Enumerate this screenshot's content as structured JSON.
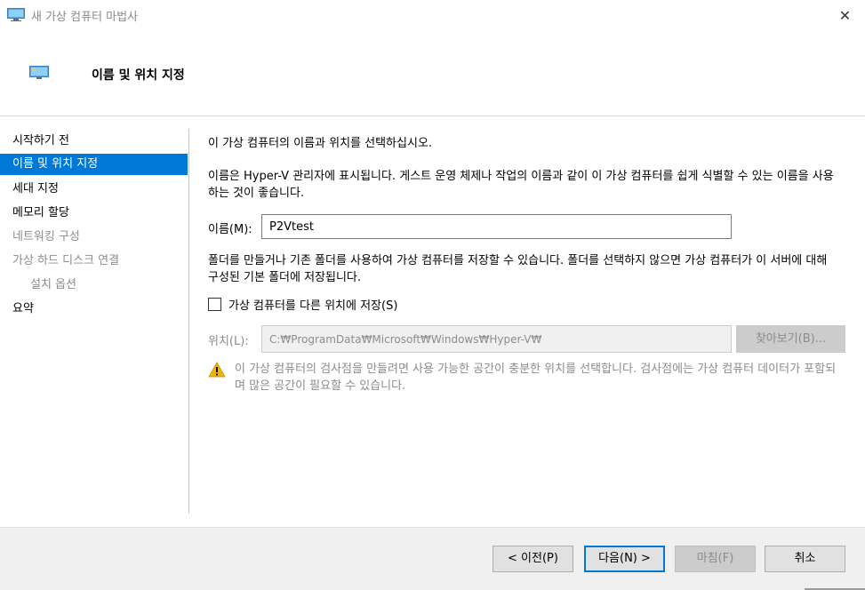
{
  "window": {
    "title": "새 가상 컴퓨터 마법사",
    "close_glyph": "✕"
  },
  "header": {
    "title": "이름 및 위치 지정"
  },
  "nav": {
    "items": [
      {
        "label": "시작하기 전",
        "state": "normal"
      },
      {
        "label": "이름 및 위치 지정",
        "state": "active"
      },
      {
        "label": "세대 지정",
        "state": "normal"
      },
      {
        "label": "메모리 할당",
        "state": "normal"
      },
      {
        "label": "네트워킹 구성",
        "state": "disabled"
      },
      {
        "label": "가상 하드 디스크 연결",
        "state": "disabled"
      },
      {
        "label": "설치 옵션",
        "state": "disabled"
      },
      {
        "label": "요약",
        "state": "normal"
      }
    ]
  },
  "content": {
    "intro": "이 가상 컴퓨터의 이름과 위치를 선택하십시오.",
    "description": "이름은 Hyper-V 관리자에 표시됩니다. 게스트 운영 체제나 작업의 이름과 같이 이 가상 컴퓨터를 쉽게 식별할 수 있는 이름을 사용하는 것이 좋습니다.",
    "name_label": "이름(M):",
    "name_value": "P2Vtest",
    "folder_description": "폴더를 만들거나 기존 폴더를 사용하여 가상 컴퓨터를 저장할 수 있습니다. 폴더를 선택하지 않으면 가상 컴퓨터가 이 서버에 대해 구성된 기본 폴더에 저장됩니다.",
    "store_checkbox_label": "가상 컴퓨터를 다른 위치에 저장(S)",
    "store_checked": false,
    "location_label": "위치(L):",
    "location_value": "C:₩ProgramData₩Microsoft₩Windows₩Hyper-V₩",
    "browse_label": "찾아보기(B)...",
    "warning_text": "이 가상 컴퓨터의 검사점을 만들려면 사용 가능한 공간이 충분한 위치를 선택합니다. 검사점에는 가상 컴퓨터 데이터가 포함되며 많은 공간이 필요할 수 있습니다."
  },
  "footer": {
    "prev_label": "< 이전(P)",
    "next_label": "다음(N) >",
    "finish_label": "마침(F)",
    "cancel_label": "취소"
  },
  "colors": {
    "accent": "#0078d7",
    "warning": "#f0b400",
    "disabled_text": "#8c8c8c"
  }
}
